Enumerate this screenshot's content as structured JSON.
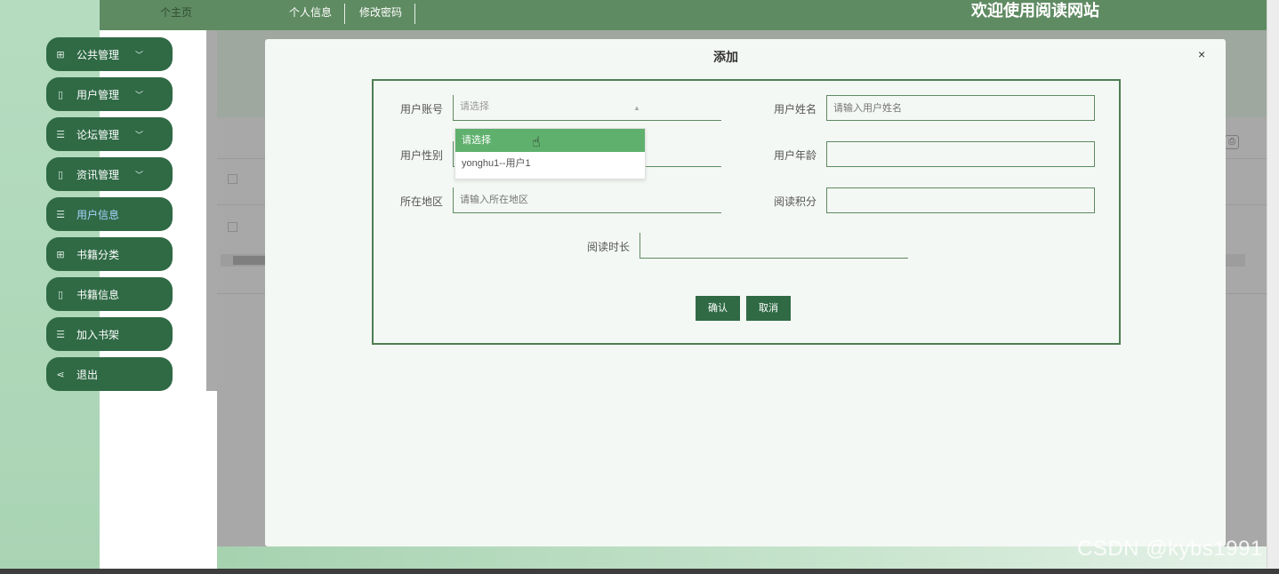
{
  "header": {
    "home_label": "个主页",
    "nav": [
      {
        "label": "个人信息"
      },
      {
        "label": "修改密码"
      }
    ],
    "welcome": "欢迎使用阅读网站"
  },
  "sidebar": {
    "items": [
      {
        "label": "公共管理",
        "icon": "grid-icon",
        "has_chevron": true
      },
      {
        "label": "用户管理",
        "icon": "book-icon",
        "has_chevron": true
      },
      {
        "label": "论坛管理",
        "icon": "list-icon",
        "has_chevron": true
      },
      {
        "label": "资讯管理",
        "icon": "book-icon",
        "has_chevron": true
      },
      {
        "label": "用户信息",
        "icon": "list-icon",
        "has_chevron": false,
        "active": true
      },
      {
        "label": "书籍分类",
        "icon": "grid-icon",
        "has_chevron": false
      },
      {
        "label": "书籍信息",
        "icon": "book-icon",
        "has_chevron": false
      },
      {
        "label": "加入书架",
        "icon": "list-icon",
        "has_chevron": false
      },
      {
        "label": "退出",
        "icon": "share-icon",
        "has_chevron": false
      }
    ]
  },
  "modal": {
    "title": "添加",
    "close": "×",
    "fields": {
      "account": {
        "label": "用户账号",
        "placeholder": "请选择"
      },
      "name": {
        "label": "用户姓名",
        "placeholder": "请输入用户姓名"
      },
      "gender": {
        "label": "用户性别",
        "placeholder": ""
      },
      "age": {
        "label": "用户年龄",
        "placeholder": ""
      },
      "region": {
        "label": "所在地区",
        "placeholder": "请输入所在地区"
      },
      "points": {
        "label": "阅读积分",
        "placeholder": ""
      },
      "duration": {
        "label": "阅读时长",
        "placeholder": ""
      }
    },
    "dropdown_options": [
      "请选择",
      "yonghu1--用户1"
    ],
    "confirm_label": "确认",
    "cancel_label": "取消"
  },
  "watermark": "CSDN @kybs1991",
  "colors": {
    "primary": "#2f6a45",
    "header": "#5f8b62",
    "selected_option": "#5fb06d"
  }
}
